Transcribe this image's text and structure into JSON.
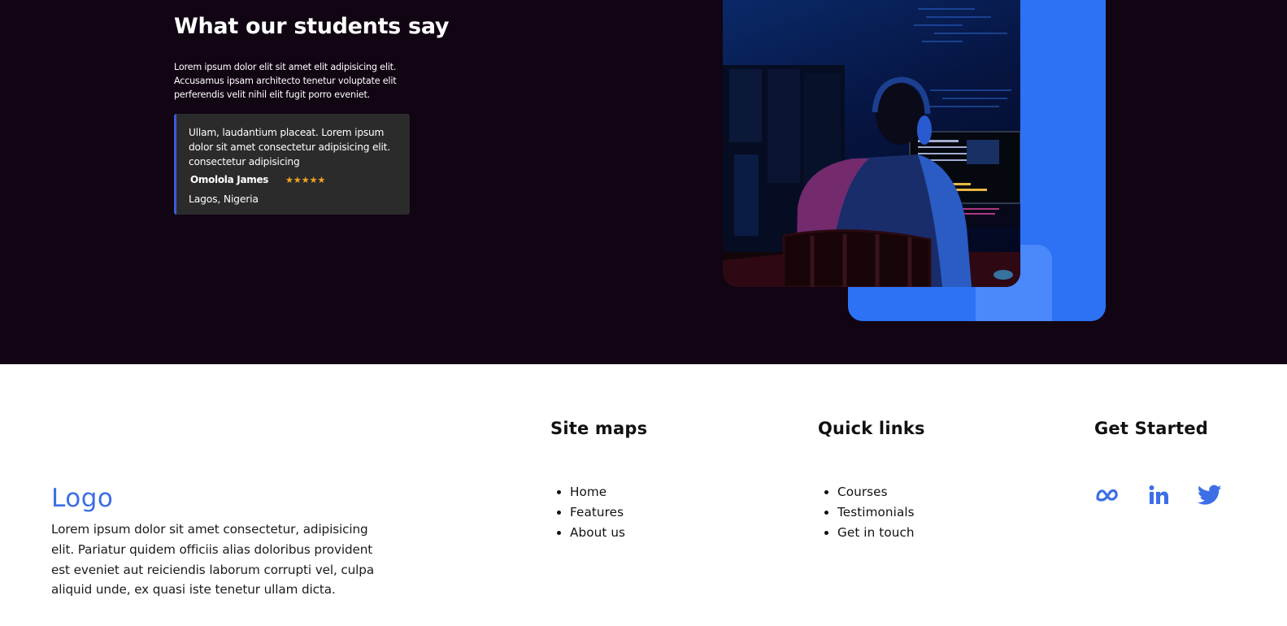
{
  "testimonials": {
    "title": "What our students say",
    "intro": "Lorem ipsum dolor elit sit amet elit adipisicing elit. Accusamus ipsam architecto tenetur voluptate elit perferendis velit nihil elit fugit porro eveniet.",
    "card": {
      "quote": "Ullam, laudantium placeat. Lorem ipsum dolor sit amet consectetur adipisicing elit. consectetur adipisicing",
      "name": "Omolola James",
      "stars": "★★★★★",
      "rating": 5,
      "location": "Lagos, Nigeria"
    },
    "accent_color": "#2d72f5"
  },
  "footer": {
    "logo": "Logo",
    "description": "Lorem ipsum dolor sit amet consectetur, adipisicing elit. Pariatur quidem officiis alias doloribus provident est eveniet aut reiciendis laborum corrupti vel, culpa aliquid unde, ex quasi iste tenetur ullam dicta.",
    "site_maps": {
      "heading": "Site maps",
      "items": [
        "Home",
        "Features",
        "About us"
      ]
    },
    "quick_links": {
      "heading": "Quick links",
      "items": [
        "Courses",
        "Testimonials",
        "Get in touch"
      ]
    },
    "get_started": {
      "heading": "Get Started",
      "icons": [
        "meta-icon",
        "linkedin-icon",
        "twitter-icon"
      ]
    },
    "brand_color": "#3c6ee6"
  }
}
